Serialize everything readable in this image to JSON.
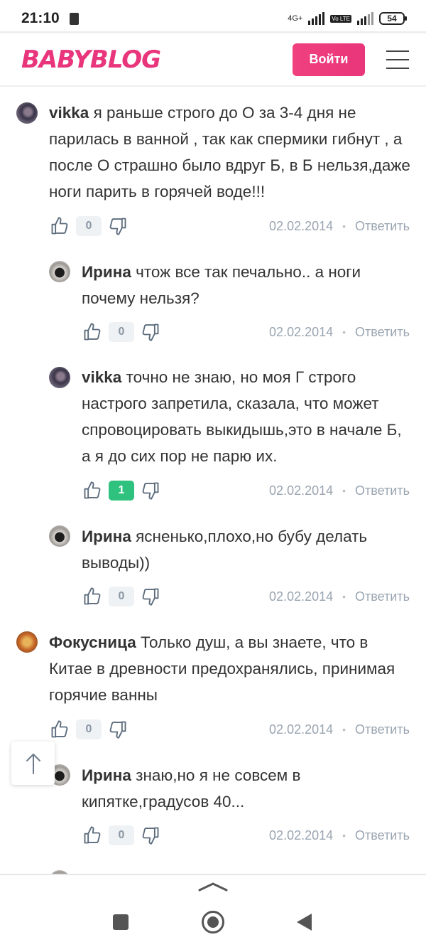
{
  "status_bar": {
    "time": "21:10",
    "network": "4G+",
    "volte": "Vo LTE",
    "battery": "54"
  },
  "header": {
    "logo": "BABYBLOG",
    "login_label": "Войти"
  },
  "comments": [
    {
      "author": "vikka",
      "text": "я раньше строго до О за 3-4 дня не парилась в ванной , так как спермики гибнут , а после О страшно было вдруг Б, в Б нельзя,даже ноги парить в горячей воде!!!",
      "likes": "0",
      "date": "02.02.2014",
      "reply_label": "Ответить"
    },
    {
      "author": "Ирина",
      "text": "чтож все так печально.. а ноги почему нельзя?",
      "likes": "0",
      "date": "02.02.2014",
      "reply_label": "Ответить"
    },
    {
      "author": "vikka",
      "text": "точно не знаю, но моя Г строго настрого запретила, сказала, что может спровоцировать выкидышь,это в начале Б, а я до сих пор не парю их.",
      "likes": "1",
      "date": "02.02.2014",
      "reply_label": "Ответить"
    },
    {
      "author": "Ирина",
      "text": "ясненько,плохо,но бубу делать выводы))",
      "likes": "0",
      "date": "02.02.2014",
      "reply_label": "Ответить"
    },
    {
      "author": "Фокусница",
      "text": "Только душ, а вы знаете, что в Китае в древности предохранялись, принимая горячие ванны",
      "likes": "0",
      "date": "02.02.2014",
      "reply_label": "Ответить"
    },
    {
      "author": "Ирина",
      "text": "знаю,но я не совсем в кипятке,градусов 40...",
      "likes": "0",
      "date": "02.02.2014",
      "reply_label": "Ответить"
    }
  ],
  "colors": {
    "brand": "#e8357c",
    "positive": "#2ec27e",
    "muted": "#9aa5b1"
  }
}
